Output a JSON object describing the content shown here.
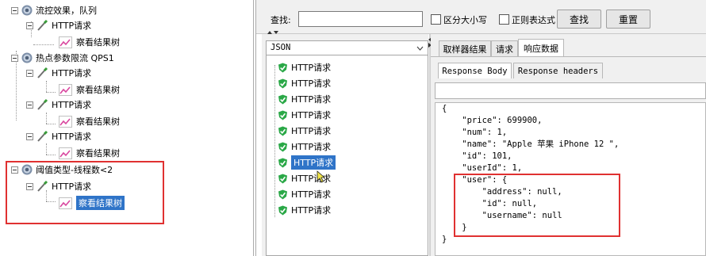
{
  "tree": {
    "nodes": [
      {
        "label": "流控效果，队列"
      },
      {
        "label": "HTTP请求"
      },
      {
        "label": "察看结果树"
      },
      {
        "label": "热点参数限流 QPS1"
      },
      {
        "label": "HTTP请求"
      },
      {
        "label": "察看结果树"
      },
      {
        "label": "HTTP请求"
      },
      {
        "label": "察看结果树"
      },
      {
        "label": "HTTP请求"
      },
      {
        "label": "察看结果树"
      },
      {
        "label": "阈值类型-线程数<2"
      },
      {
        "label": "HTTP请求"
      },
      {
        "label": "察看结果树"
      }
    ]
  },
  "search": {
    "label": "查找:",
    "value": "",
    "case_label": "区分大小写",
    "regex_label": "正则表达式",
    "find_button": "查找",
    "reset_button": "重置"
  },
  "results": {
    "renderer": "JSON",
    "items": [
      {
        "label": "HTTP请求"
      },
      {
        "label": "HTTP请求"
      },
      {
        "label": "HTTP请求"
      },
      {
        "label": "HTTP请求"
      },
      {
        "label": "HTTP请求"
      },
      {
        "label": "HTTP请求"
      },
      {
        "label": "HTTP请求"
      },
      {
        "label": "HTTP请求"
      },
      {
        "label": "HTTP请求"
      },
      {
        "label": "HTTP请求"
      }
    ]
  },
  "detail": {
    "tabs": [
      "取样器结果",
      "请求",
      "响应数据"
    ],
    "subtabs": [
      "Response Body",
      "Response headers"
    ],
    "body_lines": [
      "{",
      "    \"price\": 699900,",
      "    \"num\": 1,",
      "    \"name\": \"Apple 苹果 iPhone 12 \",",
      "    \"id\": 101,",
      "    \"userId\": 1,",
      "    \"user\": {",
      "        \"address\": null,",
      "        \"id\": null,",
      "        \"username\": null",
      "    }",
      "}"
    ]
  },
  "colors": {
    "selection": "#2f74c8",
    "annotation_box": "#e03131",
    "success_icon": "#2aa847"
  }
}
